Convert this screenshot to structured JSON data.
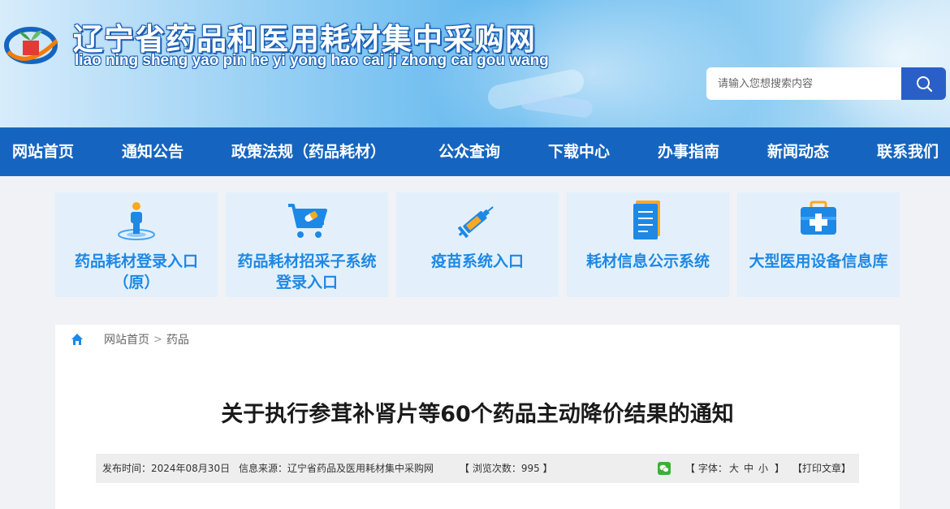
{
  "header": {
    "title": "辽宁省药品和医用耗材集中采购网",
    "pinyin": "liao ning sheng yao pin he yi yong hao cai ji zhong cai gou wang"
  },
  "search": {
    "placeholder": "请输入您想搜索内容"
  },
  "nav": {
    "items": [
      {
        "label": "网站首页"
      },
      {
        "label": "通知公告"
      },
      {
        "label": "政策法规（药品耗材）"
      },
      {
        "label": "公众查询"
      },
      {
        "label": "下载中心"
      },
      {
        "label": "办事指南"
      },
      {
        "label": "新闻动态"
      },
      {
        "label": "联系我们"
      }
    ]
  },
  "entries": [
    {
      "line1": "药品耗材登录入口",
      "line2": "（原）",
      "icon": "person-pin-icon"
    },
    {
      "line1": "药品耗材招采子系统",
      "line2": "登录入口",
      "icon": "cart-icon"
    },
    {
      "line1": "疫苗系统入口",
      "line2": "",
      "icon": "syringe-icon"
    },
    {
      "line1": "耗材信息公示系统",
      "line2": "",
      "icon": "document-icon"
    },
    {
      "line1": "大型医用设备信息库",
      "line2": "",
      "icon": "medical-kit-icon"
    }
  ],
  "breadcrumb": {
    "home": "网站首页",
    "current": "药品"
  },
  "article": {
    "title": "关于执行参茸补肾片等60个药品主动降价结果的通知",
    "publish": "发布时间：2024年08月30日",
    "source": "信息来源：辽宁省药品及医用耗材集中采购网",
    "views": "【  浏览次数：995  】",
    "font_prefix": "【  字体：",
    "font_large": "大",
    "font_medium": "中",
    "font_small": "小",
    "font_suffix": "】",
    "print": "【打印文章】"
  },
  "colors": {
    "nav_bg": "#1565c0",
    "accent": "#1e88e5",
    "entry_bg": "#e3f0fb",
    "search_btn": "#2b5fc8"
  }
}
